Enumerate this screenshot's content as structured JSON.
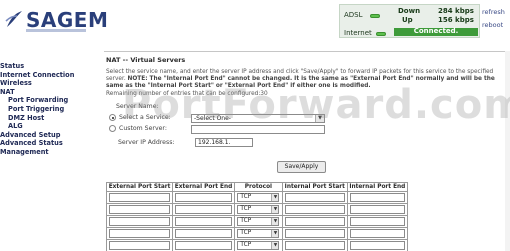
{
  "brand": {
    "logo": "SAGEM"
  },
  "status": {
    "adsl_label": "ADSL",
    "down_label": "Down",
    "down_value": "284 kbps",
    "up_label": "Up",
    "up_value": "156 kbps",
    "internet_label": "Internet",
    "connected_text": "Connected.",
    "led_color": "#5ec04e",
    "connected_color": "#3e9b3a"
  },
  "util": {
    "refresh": "refresh",
    "reboot": "reboot"
  },
  "sidebar": {
    "items": [
      {
        "label": "Status",
        "sub": false
      },
      {
        "label": "Internet Connection",
        "sub": false
      },
      {
        "label": "Wireless",
        "sub": false
      },
      {
        "label": "NAT",
        "sub": false
      },
      {
        "label": "Port Forwarding",
        "sub": true
      },
      {
        "label": "Port Triggering",
        "sub": true
      },
      {
        "label": "DMZ Host",
        "sub": true
      },
      {
        "label": "ALG",
        "sub": true
      },
      {
        "label": "Advanced Setup",
        "sub": false
      },
      {
        "label": "Advanced Status",
        "sub": false
      },
      {
        "label": "Management",
        "sub": false
      }
    ]
  },
  "main": {
    "title": "NAT -- Virtual Servers",
    "intro_1": "Select the service name, and enter the server IP address and click \"Save/Apply\" to forward IP packets for this service to the specified server. ",
    "intro_note": "NOTE: The \"Internal Port End\" cannot be changed. It is the same as \"External Port End\" normally and will be the same as the \"Internal Port Start\" or \"External Port End\" if either one is modified.",
    "intro_2": "Remaining number of entries that can be configured:30",
    "server_name_label": "Server Name:",
    "select_service_label": "Select a Service:",
    "select_service_value": "-Select One-",
    "custom_server_label": "Custom Server:",
    "server_ip_label": "Server IP Address:",
    "server_ip_value": "192.168.1.",
    "save_apply": "Save/Apply",
    "table": {
      "headers": [
        "External Port Start",
        "External Port End",
        "Protocol",
        "Internal Port Start",
        "Internal Port End"
      ],
      "rows": [
        {
          "protocol": "TCP"
        },
        {
          "protocol": "TCP"
        },
        {
          "protocol": "TCP"
        },
        {
          "protocol": "TCP"
        },
        {
          "protocol": "TCP"
        }
      ]
    }
  },
  "watermark": "PortForward.com"
}
